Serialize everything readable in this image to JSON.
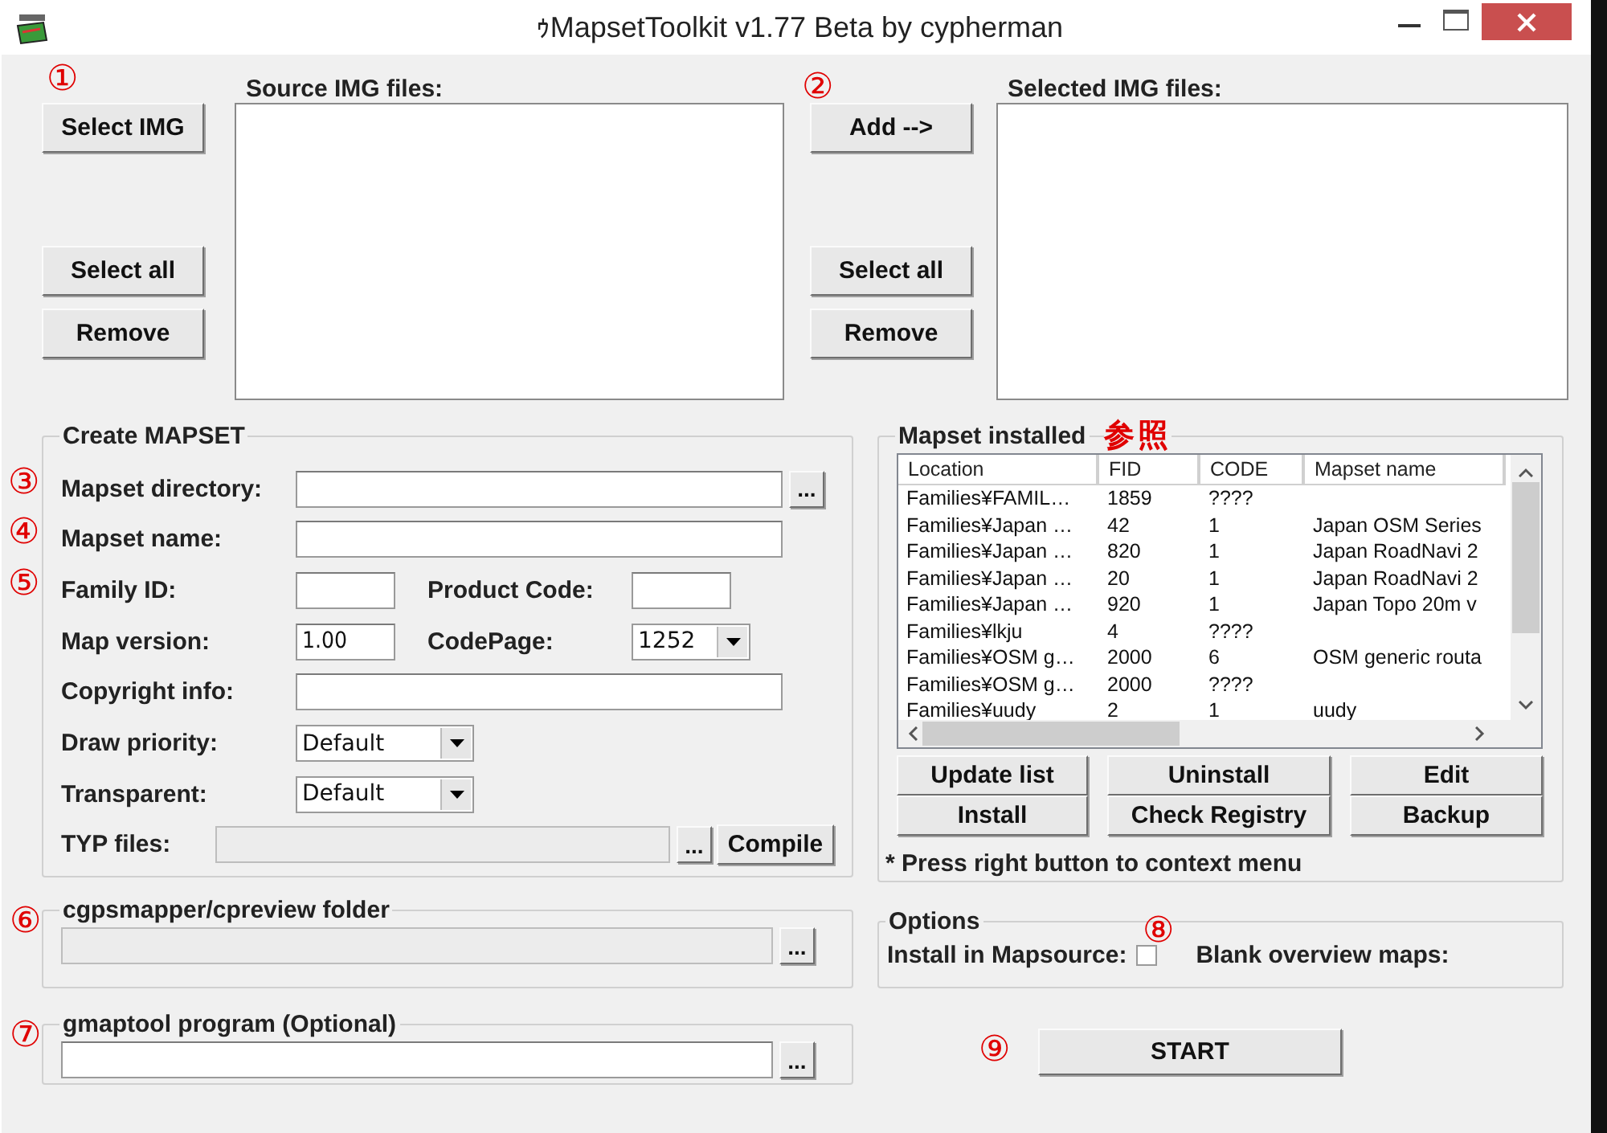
{
  "window": {
    "title": "ｩMapsetToolkit v1.77 Beta by cypherman"
  },
  "source": {
    "marker": "①",
    "label": "Source IMG files:",
    "buttons": [
      "Select IMG",
      "Select all",
      "Remove"
    ]
  },
  "selected": {
    "marker": "②",
    "label": "Selected IMG files:",
    "buttons": [
      "Add -->",
      "Select all",
      "Remove"
    ]
  },
  "create_mapset": {
    "title": "Create MAPSET",
    "fields": [
      {
        "kind": "path",
        "marker": "③",
        "label": "Mapset directory:",
        "browse": "..."
      },
      {
        "kind": "text",
        "marker": "④",
        "label": "Mapset name:"
      },
      {
        "kind": "pair",
        "marker": "⑤",
        "label": "Family ID:",
        "label_2": "Product Code:"
      },
      {
        "kind": "pair-select",
        "label": "Map version:",
        "value": "1.00",
        "label_2": "CodePage:",
        "value_2": "1252"
      },
      {
        "kind": "text",
        "label": "Copyright info:"
      },
      {
        "kind": "select",
        "label": "Draw priority:",
        "value": "Default"
      },
      {
        "kind": "select",
        "label": "Transparent:",
        "value": "Default"
      },
      {
        "kind": "typ",
        "label": "TYP files:",
        "disabled": true,
        "browse": "...",
        "button": "Compile"
      }
    ]
  },
  "cgpsmapper": {
    "marker": "⑥",
    "title": "cgpsmapper/cpreview folder",
    "disabled": true,
    "browse": "..."
  },
  "gmaptool": {
    "marker": "⑦",
    "title": "gmaptool program (Optional)",
    "disabled": false,
    "browse": "..."
  },
  "installed": {
    "title": "Mapset installed",
    "note": "参照",
    "columns": [
      "Location",
      "FID",
      "CODE",
      "Mapset name"
    ],
    "rows": [
      [
        "Families¥FAMIL…",
        "1859",
        "????",
        ""
      ],
      [
        "Families¥Japan …",
        "42",
        "1",
        "Japan OSM Series"
      ],
      [
        "Families¥Japan …",
        "820",
        "1",
        "Japan RoadNavi 2"
      ],
      [
        "Families¥Japan …",
        "20",
        "1",
        "Japan RoadNavi 2"
      ],
      [
        "Families¥Japan …",
        "920",
        "1",
        "Japan Topo 20m v"
      ],
      [
        "Families¥lkju",
        "4",
        "????",
        ""
      ],
      [
        "Families¥OSM g…",
        "2000",
        "6",
        "OSM generic routa"
      ],
      [
        "Families¥OSM g…",
        "2000",
        "????",
        ""
      ],
      [
        "Families¥uudy",
        "2",
        "1",
        "uudy"
      ]
    ],
    "buttons": [
      "Update list",
      "Uninstall",
      "Edit",
      "Install",
      "Check Registry",
      "Backup"
    ],
    "hint": "* Press right button to context menu"
  },
  "options": {
    "title": "Options",
    "marker": "⑧",
    "checkboxes": [
      {
        "label": "Install in Mapsource:",
        "checked": false
      }
    ],
    "label_2": "Blank overview maps:"
  },
  "start": {
    "marker": "⑨",
    "label": "START"
  }
}
